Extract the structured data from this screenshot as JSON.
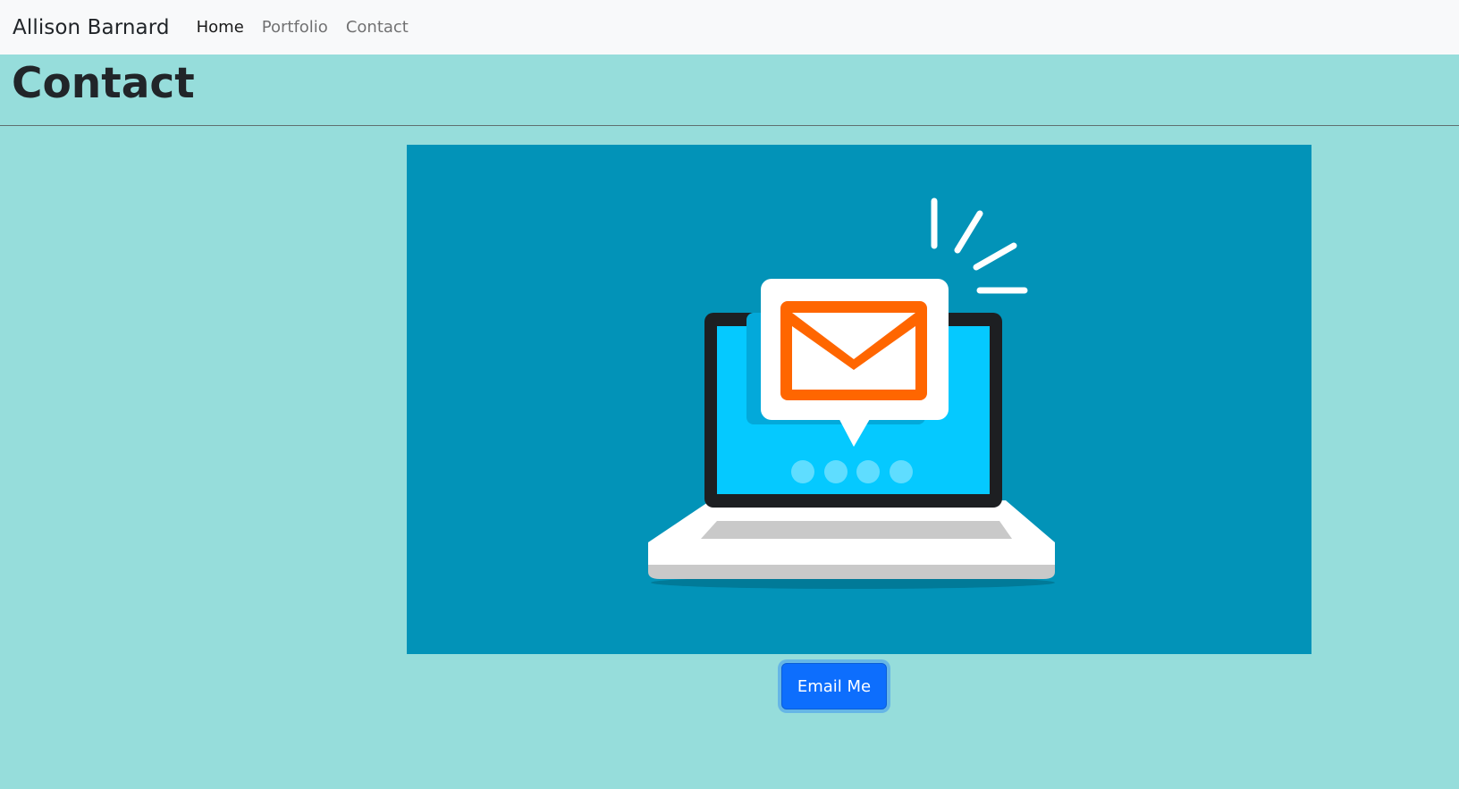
{
  "navbar": {
    "brand": "Allison Barnard",
    "links": [
      {
        "label": "Home",
        "active": true
      },
      {
        "label": "Portfolio",
        "active": false
      },
      {
        "label": "Contact",
        "active": false
      }
    ]
  },
  "page": {
    "title": "Contact"
  },
  "hero": {
    "icon": "laptop-email-illustration",
    "colors": {
      "background": "#0293B8",
      "screen": "#05C9FF",
      "envelope": "#FF6600"
    }
  },
  "actions": {
    "email_label": "Email Me"
  },
  "colors": {
    "page_background": "#96DDDB",
    "navbar_background": "#F8F9FA",
    "button": "#0D6EFD"
  }
}
